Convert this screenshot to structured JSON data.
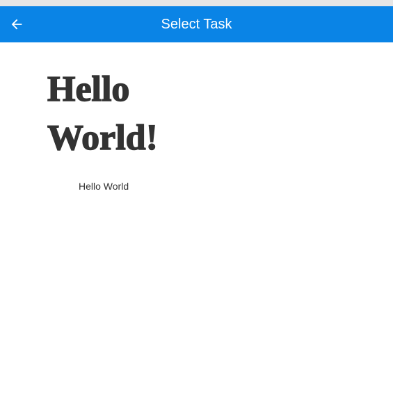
{
  "header": {
    "title": "Select Task",
    "back_icon": "arrow-left-icon",
    "background_color": "#0a84e6"
  },
  "content": {
    "image_text_line1": "Hello",
    "image_text_line2": "World!",
    "caption": "Hello World"
  }
}
